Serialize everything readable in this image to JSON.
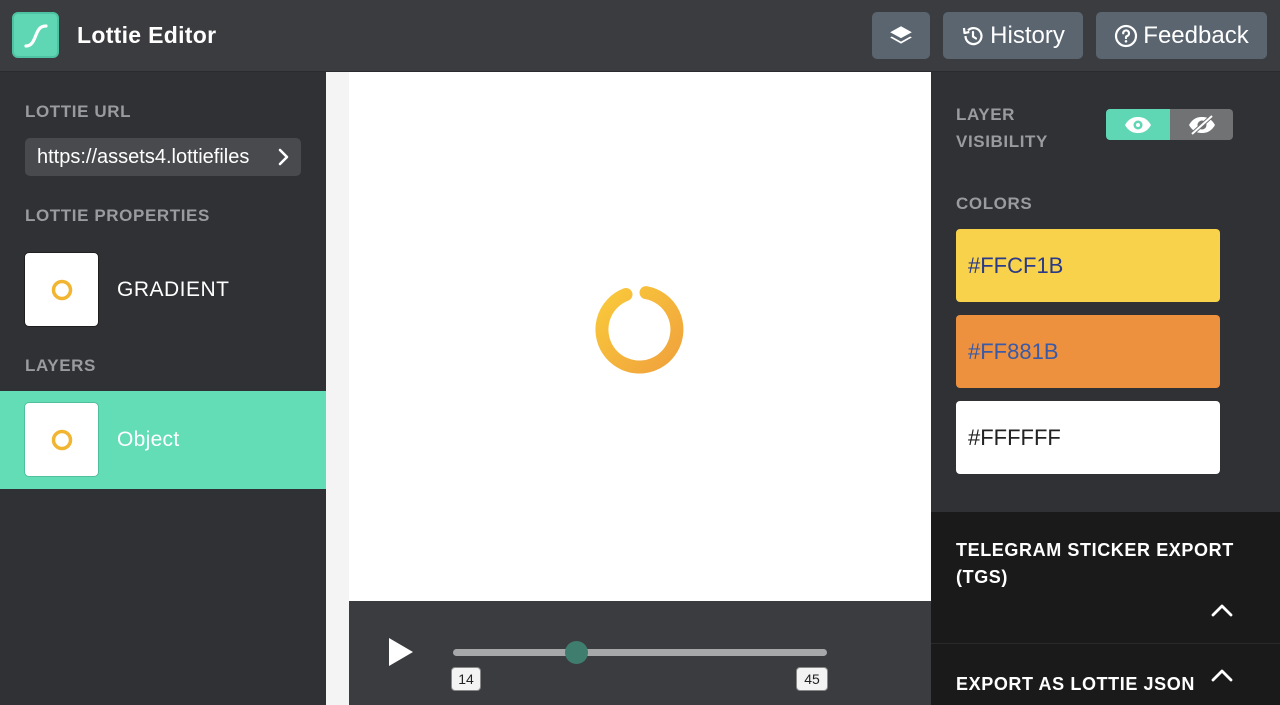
{
  "header": {
    "title": "Lottie Editor",
    "history_label": "History",
    "feedback_label": "Feedback",
    "accent_color": "#5fd6b4"
  },
  "sidebar": {
    "url_label": "LOTTIE URL",
    "url_value": "https://assets4.lottiefiles",
    "properties_label": "LOTTIE PROPERTIES",
    "property_item": "GRADIENT",
    "layers_label": "LAYERS",
    "layer_item": "Object",
    "layer_selected_color": "#63ddb6"
  },
  "player": {
    "frame_start": "14",
    "frame_end": "45",
    "current_progress": 0.33
  },
  "right_panel": {
    "visibility_label_line1": "LAYER",
    "visibility_label_line2": "VISIBILITY",
    "colors_label": "COLORS",
    "colors": [
      {
        "hex": "#FFCF1B",
        "bg": "#f8d24a",
        "text": "#2a3a8a"
      },
      {
        "hex": "#FF881B",
        "bg": "#ee913e",
        "text": "#3a5aa8"
      },
      {
        "hex": "#FFFFFF",
        "bg": "#ffffff",
        "text": "#222222"
      }
    ]
  },
  "exports": {
    "tgs_label": "TELEGRAM STICKER EXPORT (TGS)",
    "json_label": "EXPORT AS LOTTIE JSON"
  }
}
